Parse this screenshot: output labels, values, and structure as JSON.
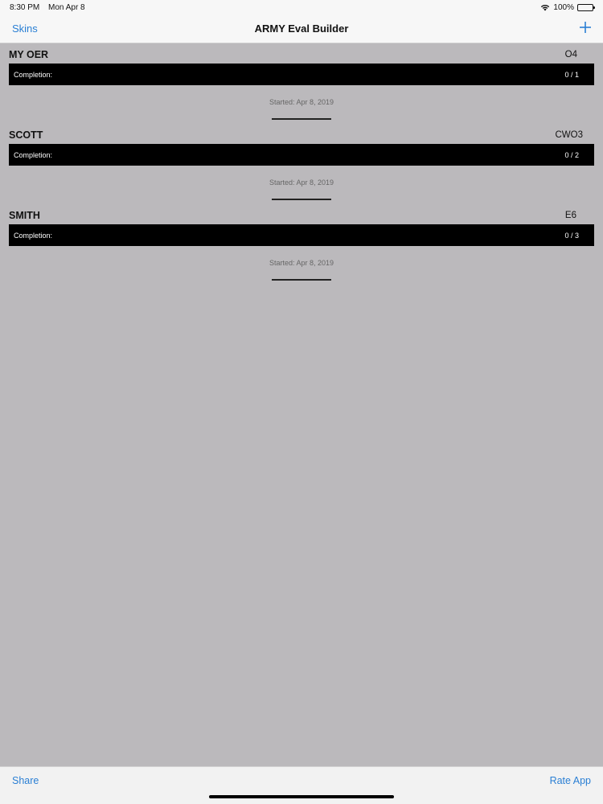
{
  "status_bar": {
    "time": "8:30 PM",
    "date": "Mon Apr 8",
    "battery": "100%",
    "icons": [
      "wifi-icon",
      "battery-icon"
    ]
  },
  "nav": {
    "left_label": "Skins",
    "title": "ARMY Eval Builder",
    "right_icon": "plus-icon"
  },
  "evals": [
    {
      "name": "MY OER",
      "rank": "O4",
      "completion_label": "Completion:",
      "completion_count": "0 / 1",
      "started": "Started: Apr 8, 2019"
    },
    {
      "name": "SCOTT",
      "rank": "CWO3",
      "completion_label": "Completion:",
      "completion_count": "0 / 2",
      "started": "Started: Apr 8, 2019"
    },
    {
      "name": "SMITH",
      "rank": "E6",
      "completion_label": "Completion:",
      "completion_count": "0 / 3",
      "started": "Started: Apr 8, 2019"
    }
  ],
  "toolbar": {
    "share_label": "Share",
    "rate_label": "Rate App"
  },
  "colors": {
    "accent": "#2a7fd4",
    "background": "#bbb9bc",
    "bar": "#000000"
  }
}
